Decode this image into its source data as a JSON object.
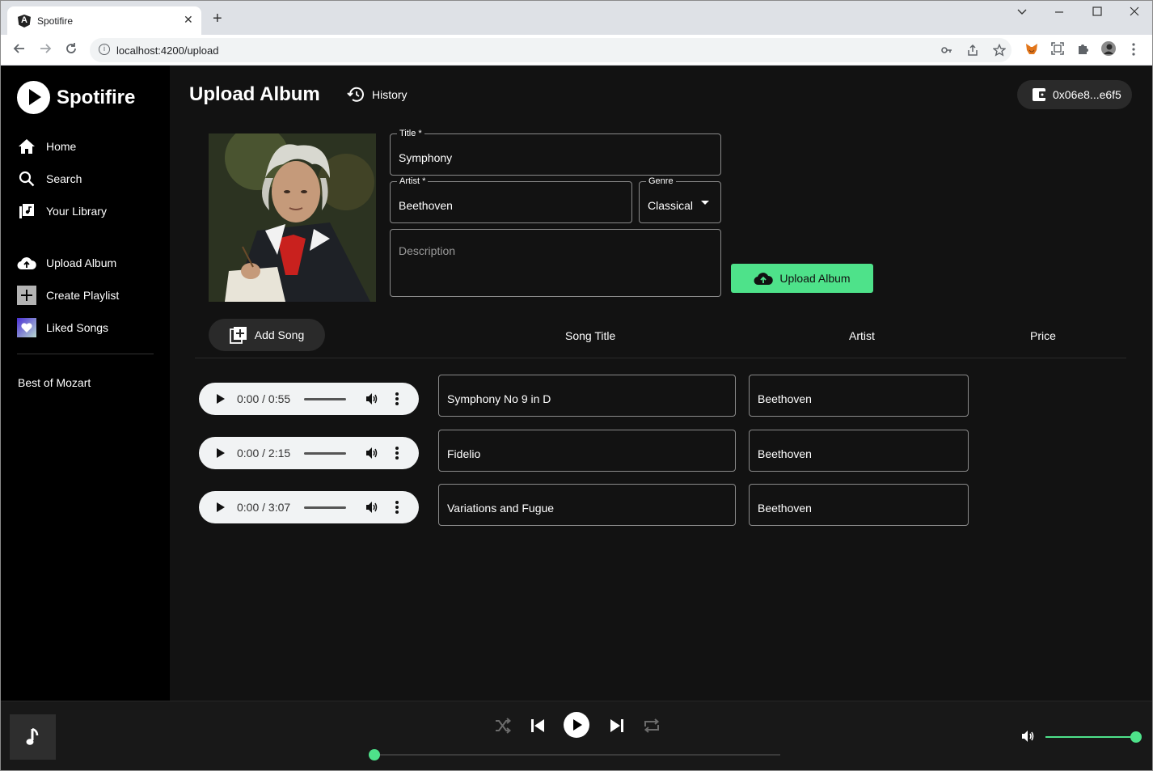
{
  "browser": {
    "tab_title": "Spotifire",
    "url": "localhost:4200/upload"
  },
  "sidebar": {
    "brand": "Spotifire",
    "items": [
      {
        "label": "Home",
        "icon": "home-icon"
      },
      {
        "label": "Search",
        "icon": "search-icon"
      },
      {
        "label": "Your Library",
        "icon": "library-icon"
      },
      {
        "label": "Upload Album",
        "icon": "cloud-upload-icon"
      },
      {
        "label": "Create Playlist",
        "icon": "plus-box-icon"
      },
      {
        "label": "Liked Songs",
        "icon": "heart-icon"
      }
    ],
    "playlists": [
      "Best of Mozart"
    ]
  },
  "header": {
    "title": "Upload Album",
    "history_label": "History",
    "wallet_label": "0x06e8...e6f5"
  },
  "form": {
    "title_label": "Title *",
    "title_value": "Symphony",
    "artist_label": "Artist *",
    "artist_value": "Beethoven",
    "genre_label": "Genre",
    "genre_value": "Classical",
    "description_placeholder": "Description",
    "upload_button": "Upload Album"
  },
  "songs": {
    "add_song_label": "Add Song",
    "columns": [
      "Song Title",
      "Artist",
      "Price"
    ],
    "rows": [
      {
        "time": "0:00 / 0:55",
        "title": "Symphony No 9 in D",
        "artist": "Beethoven"
      },
      {
        "time": "0:00 / 2:15",
        "title": "Fidelio",
        "artist": "Beethoven"
      },
      {
        "time": "0:00 / 3:07",
        "title": "Variations and Fugue",
        "artist": "Beethoven"
      }
    ]
  },
  "player": {
    "progress": 0.0,
    "volume": 1.0
  },
  "colors": {
    "accent": "#4ee28a",
    "background": "#121212",
    "sidebar": "#000000"
  }
}
